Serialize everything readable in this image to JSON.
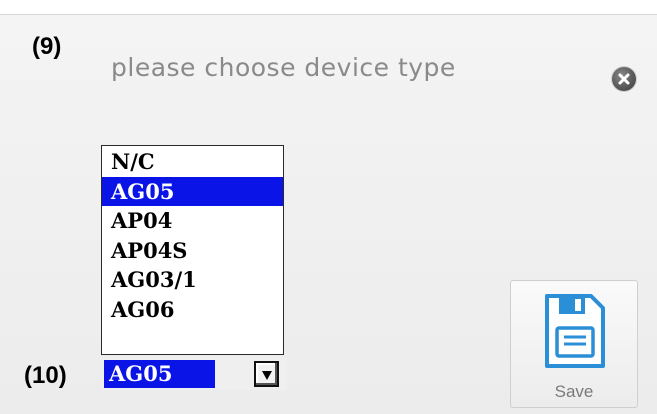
{
  "annotations": {
    "top_left": "(9)",
    "bottom_left": "(10)"
  },
  "dialog": {
    "title": "please choose device type",
    "close_icon": "close-circle-icon"
  },
  "device_list": {
    "items": [
      "N/C",
      "AG05",
      "AP04",
      "AP04S",
      "AG03/1",
      "AG06"
    ],
    "selected": "AG05"
  },
  "device_select": {
    "value": "AG05",
    "arrow_icon": "dropdown-arrow-icon"
  },
  "save_button": {
    "label": "Save",
    "icon": "floppy-disk-icon"
  },
  "colors": {
    "selection": "#0a14e6",
    "icon_accent": "#2a8fd6",
    "title_text": "#8a8a8a"
  }
}
